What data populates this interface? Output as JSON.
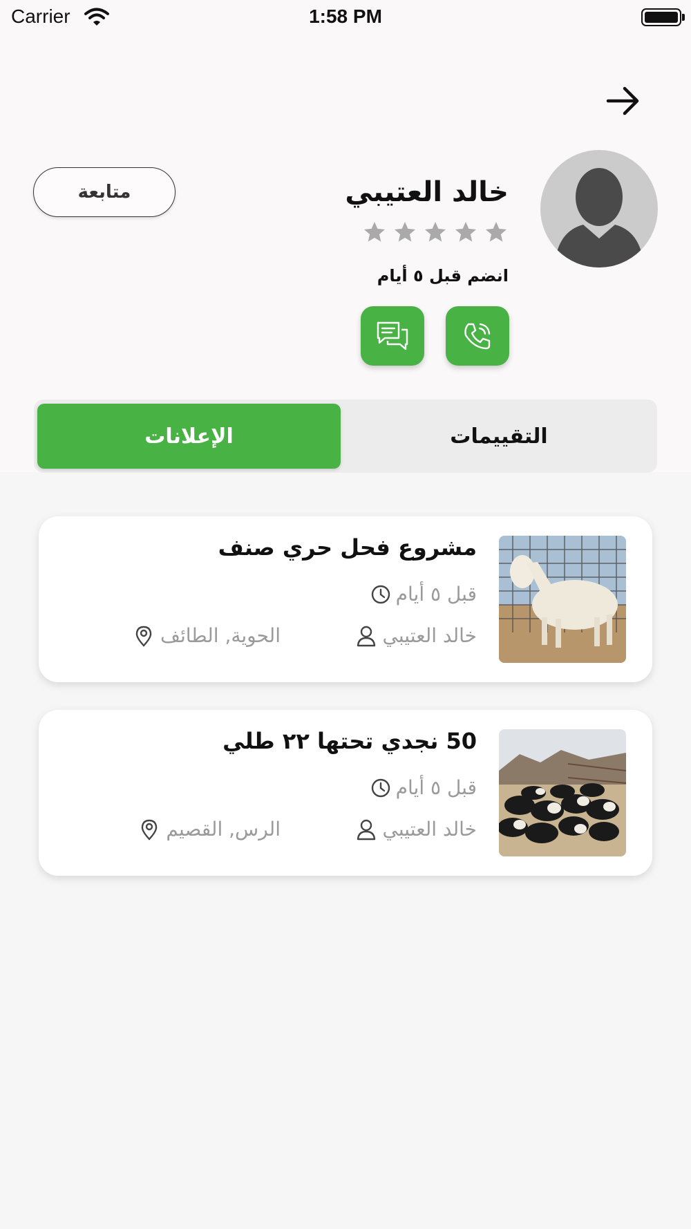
{
  "status_bar": {
    "carrier": "Carrier",
    "time": "1:58 PM"
  },
  "profile": {
    "name": "خالد العتيبي",
    "rating_stars": 5,
    "rating_filled": 0,
    "joined": "انضم  قبل ٥ أيام",
    "follow_label": "متابعة"
  },
  "tabs": [
    {
      "label": "الإعلانات",
      "active": true
    },
    {
      "label": "التقييمات",
      "active": false
    }
  ],
  "ads": [
    {
      "title": "مشروع فحل حري صنف",
      "time": "قبل ٥ أيام",
      "user": "خالد العتيبي",
      "location": "الحوية, الطائف"
    },
    {
      "title": "50 نجدي تحتها ٢٢ طلي",
      "time": "قبل ٥ أيام",
      "user": "خالد العتيبي",
      "location": "الرس, القصيم"
    }
  ],
  "colors": {
    "accent": "#48b244",
    "muted": "#9a9a9a",
    "star": "#aaaaaa"
  },
  "icons": [
    "wifi-icon",
    "battery-icon",
    "back-arrow-icon",
    "phone-icon",
    "chat-icon",
    "star-icon",
    "clock-icon",
    "user-icon",
    "location-pin-icon"
  ]
}
